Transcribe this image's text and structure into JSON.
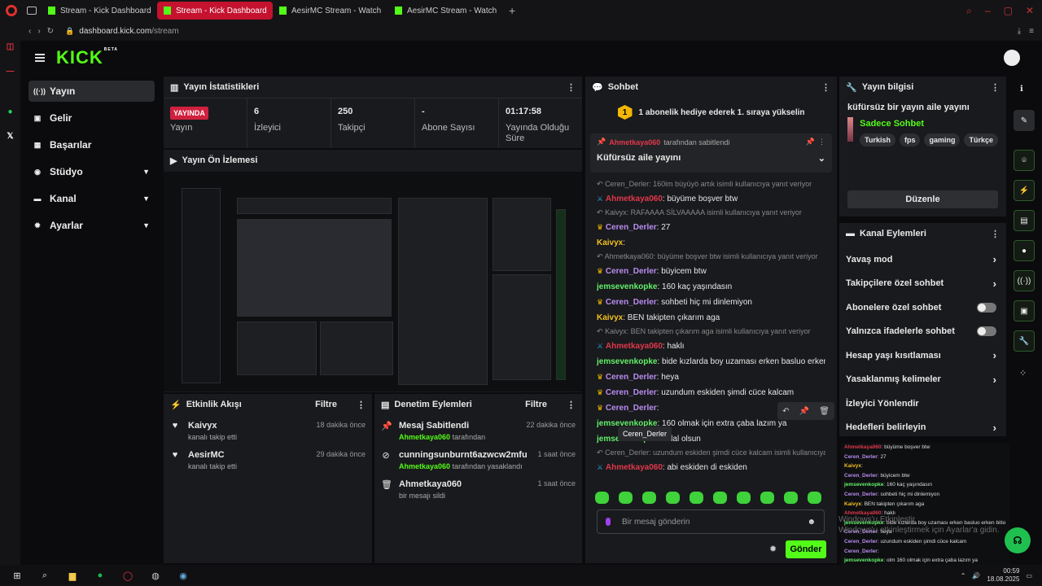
{
  "browser": {
    "tabs": [
      {
        "label": "Stream - Kick Dashboard"
      },
      {
        "label": "Stream - Kick Dashboard"
      },
      {
        "label": "AesirMC Stream - Watch"
      },
      {
        "label": "AesirMC Stream - Watch"
      }
    ],
    "new_tab": "+",
    "url_host": "dashboard.kick.com",
    "url_path": "/stream"
  },
  "app": {
    "logo": "KICK",
    "beta": "BETA"
  },
  "sidenav": [
    {
      "label": "Yayın",
      "icon": "broadcast-icon"
    },
    {
      "label": "Gelir",
      "icon": "wallet-icon"
    },
    {
      "label": "Başarılar",
      "icon": "trophy-icon"
    },
    {
      "label": "Stüdyo",
      "icon": "studio-icon"
    },
    {
      "label": "Kanal",
      "icon": "channel-icon"
    },
    {
      "label": "Ayarlar",
      "icon": "gear-icon"
    }
  ],
  "stats": {
    "title": "Yayın İstatistikleri",
    "live": "YAYINDA",
    "live_label": "Yayın",
    "viewers": "6",
    "viewers_label": "İzleyici",
    "followers": "250",
    "followers_label": "Takipçi",
    "subs": "-",
    "subs_label": "Abone Sayısı",
    "uptime": "01:17:58",
    "uptime_label": "Yayında Olduğu Süre"
  },
  "preview": {
    "title": "Yayın Ön İzlemesi"
  },
  "activity": {
    "title": "Etkinlik Akışı",
    "filter": "Filtre",
    "items": [
      {
        "name": "Kaivyx",
        "sub": "kanalı takip etti",
        "time": "18 dakika önce"
      },
      {
        "name": "AesirMC",
        "sub": "kanalı takip etti",
        "time": "29 dakika önce"
      }
    ]
  },
  "moderation": {
    "title": "Denetim Eylemleri",
    "filter": "Filtre",
    "items": [
      {
        "name": "Mesaj Sabitlendi",
        "user": "Ahmetkaya060",
        "sub": "tarafından",
        "time": "22 dakika önce"
      },
      {
        "name": "cunningsunburnt6azwcw2mfu",
        "user": "Ahmetkaya060",
        "sub": "tarafından yasaklandı",
        "time": "1 saat önce"
      },
      {
        "name": "Ahmetkaya060",
        "user": "",
        "sub": "bir mesajı sildi",
        "time": "1 saat önce"
      }
    ]
  },
  "chat": {
    "title": "Sohbet",
    "banner_rank": "1",
    "banner": "1 abonelik hediye ederek 1. sıraya yükselin",
    "pin_user": "Ahmetkaya060",
    "pin_by": "tarafından sabitlendi",
    "pin_text": "Küfürsüz aile yayını",
    "messages": [
      {
        "reply": "Ceren_Derler: 160im büyüyö artık",
        "reply_tail": "isimli kullanıcıya yanıt veriyor"
      },
      {
        "user": "Ahmetkaya060",
        "cls": "u-red",
        "badge": "mod",
        "text": ": büyüme boşver btw"
      },
      {
        "reply": "Kaivyx: RAFAAAA SİLVAAAAA isimli kullanıcıya yanıt veriyor"
      },
      {
        "user": "Ceren_Derler",
        "cls": "u-pur",
        "badge": "crown",
        "text": ": 27"
      },
      {
        "user": "Kaivyx",
        "cls": "u-yel",
        "badge": "",
        "text": ":"
      },
      {
        "reply": "Ahmetkaya060: büyüme boşver btw isimli kullanıcıya yanıt veriyor"
      },
      {
        "user": "Ceren_Derler",
        "cls": "u-pur",
        "badge": "crown",
        "text": ": büyicem btw"
      },
      {
        "user": "jemsevenkopke",
        "cls": "u-grn",
        "badge": "",
        "text": ": 160 kaç yaşındasın"
      },
      {
        "user": "Ceren_Derler",
        "cls": "u-pur",
        "badge": "crown",
        "text": ": sohbeti hiç mi dinlemiyon"
      },
      {
        "user": "Kaivyx",
        "cls": "u-yel",
        "badge": "",
        "text": ": BEN takipten çıkarım aga"
      },
      {
        "reply": "Kaivyx: BEN takipten çıkarım aga isimli kullanıcıya yanıt veriyor"
      },
      {
        "user": "Ahmetkaya060",
        "cls": "u-red",
        "badge": "mod",
        "text": ": haklı"
      },
      {
        "user": "jemsevenkopke",
        "cls": "u-grn",
        "badge": "",
        "text": ": bide kızlarda boy uzaması erken basluo erken bitio"
      },
      {
        "user": "Ceren_Derler",
        "cls": "u-pur",
        "badge": "crown",
        "text": ": heya"
      },
      {
        "user": "Ceren_Derler",
        "cls": "u-pur",
        "badge": "crown",
        "text": ": uzundum eskiden şimdi cüce kalcam"
      },
      {
        "user": "Ceren_Derler",
        "cls": "u-pur",
        "badge": "crown",
        "text": ":"
      },
      {
        "user": "jemsevenkopke",
        "cls": "u-grn",
        "badge": "",
        "text": ": 160 olmak için extra çaba lazım ya"
      },
      {
        "user": "jemsevenkopke",
        "cls": "u-grn",
        "badge": "",
        "text": ": helal olsun"
      },
      {
        "reply": "Ceren_Derler: uzundum eskiden şimdi cüce kalcam isimli kullanıcıya..."
      },
      {
        "user": "Ahmetkaya060",
        "cls": "u-red",
        "badge": "mod",
        "text": ": abi eskiden di eskiden"
      }
    ],
    "tooltip": "Ceren_Derler",
    "input_placeholder": "Bir mesaj gönderin",
    "send": "Gönder"
  },
  "info": {
    "title": "Yayın bilgisi",
    "desc": "küfürsüz bir yayın aile yayını",
    "category": "Sadece Sohbet",
    "tags": [
      "Turkish",
      "fps",
      "gaming",
      "Türkçe"
    ],
    "edit": "Düzenle"
  },
  "channel_actions": {
    "title": "Kanal Eylemleri",
    "rows": [
      {
        "label": "Yavaş mod",
        "ctl": "arrow"
      },
      {
        "label": "Takipçilere özel sohbet",
        "ctl": "arrow"
      },
      {
        "label": "Abonelere özel sohbet",
        "ctl": "toggle"
      },
      {
        "label": "Yalnızca ifadelerle sohbet",
        "ctl": "toggle"
      },
      {
        "label": "Hesap yaşı kısıtlaması",
        "ctl": "arrow"
      },
      {
        "label": "Yasaklanmış kelimeler",
        "ctl": "arrow"
      },
      {
        "label": "İzleyici Yönlendir",
        "ctl": "none"
      },
      {
        "label": "Hedefleri belirleyin",
        "ctl": "arrow"
      }
    ]
  },
  "minichat": [
    {
      "user": "Ahmetkaya060",
      "cls": "u-red",
      "text": ": büyüme boşver btw"
    },
    {
      "user": "Ceren_Derler",
      "cls": "u-pur",
      "text": ": 27"
    },
    {
      "user": "Kaivyx",
      "cls": "u-yel",
      "text": ":"
    },
    {
      "user": "Ceren_Derler",
      "cls": "u-pur",
      "text": ": büyicem btw"
    },
    {
      "user": "jemsevenkopke",
      "cls": "u-grn",
      "text": ": 160 kaç yaşındasın"
    },
    {
      "user": "Ceren_Derler",
      "cls": "u-pur",
      "text": ": sohbeti hiç mi dinlemiyon"
    },
    {
      "user": "Kaivyx",
      "cls": "u-yel",
      "text": ": BEN takipten çıkarım aga"
    },
    {
      "user": "Ahmetkaya060",
      "cls": "u-red",
      "text": ": haklı"
    },
    {
      "user": "jemsevenkopke",
      "cls": "u-grn",
      "text": ": bide kızlarda boy uzaması erken basluo erken bitio"
    },
    {
      "user": "Ceren_Derler",
      "cls": "u-pur",
      "text": ": heya"
    },
    {
      "user": "Ceren_Derler",
      "cls": "u-pur",
      "text": ": uzundum eskiden şimdi cüce kalcam"
    },
    {
      "user": "Ceren_Derler",
      "cls": "u-pur",
      "text": ":"
    },
    {
      "user": "jemsevenkopke",
      "cls": "u-grn",
      "text": ": olm 160 olmak için extra çaba lazım ya"
    },
    {
      "user": "jemsevenkopke",
      "cls": "u-grn",
      "text": ": helal olsun"
    },
    {
      "user": "Ahmetkaya060",
      "cls": "u-red",
      "text": ": abi eskiden di eskiden"
    }
  ],
  "watermark": {
    "line1": "Windows'u Etkinleştir",
    "line2": "Windows'u etkinleştirmek için Ayarlar'a gidin."
  },
  "taskbar": {
    "time": "00:59",
    "date": "18.08.2025"
  },
  "colors": {
    "accent": "#53fc18",
    "live": "#d0203e",
    "tab_active": "#c4122f"
  }
}
